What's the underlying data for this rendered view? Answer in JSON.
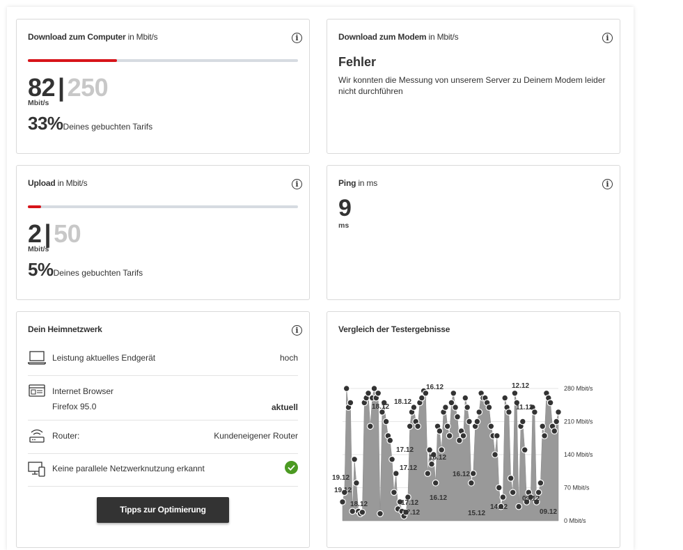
{
  "download_computer": {
    "title_bold": "Download zum Computer",
    "title_unit": "in Mbit/s",
    "value": "82",
    "separator": "|",
    "max": "250",
    "unit": "Mbit/s",
    "percent": "33%",
    "percent_text": "Deines gebuchten Tarifs",
    "progress": 0.33
  },
  "download_modem": {
    "title_bold": "Download zum Modem",
    "title_unit": "in Mbit/s",
    "error_heading": "Fehler",
    "error_text": "Wir konnten die Messung von unserem Server zu Deinem Modem leider nicht durchführen"
  },
  "upload": {
    "title_bold": "Upload",
    "title_unit": "in Mbit/s",
    "value": "2",
    "separator": "|",
    "max": "50",
    "unit": "Mbit/s",
    "percent": "5%",
    "percent_text": "Deines gebuchten Tarifs",
    "progress": 0.05
  },
  "ping": {
    "title_bold": "Ping",
    "title_unit": "in ms",
    "value": "9",
    "unit": "ms"
  },
  "home_network": {
    "title": "Dein Heimnetzwerk",
    "rows": [
      {
        "icon": "laptop-icon",
        "label": "Leistung aktuelles Endgerät",
        "value": "hoch"
      },
      {
        "icon": "browser-icon",
        "label": "Internet Browser",
        "sublabel": "Firefox 95.0",
        "value": "aktuell"
      },
      {
        "icon": "router-icon",
        "label": "Router:",
        "value": "Kundeneigener Router"
      },
      {
        "icon": "devices-icon",
        "label": "Keine parallele Netzwerknutzung erkannt",
        "value_icon": "check-icon"
      }
    ],
    "button": "Tipps zur Optimierung"
  },
  "comparison": {
    "title": "Vergleich der Testergebnisse"
  },
  "colors": {
    "accent": "#d7141a",
    "check": "#4b9a22",
    "area": "#999999",
    "button": "#333333"
  },
  "chart_data": {
    "type": "area",
    "y_unit": "Mbit/s",
    "ylim": [
      0,
      280
    ],
    "y_ticks": [
      "280 Mbit/s",
      "210 Mbit/s",
      "140 Mbit/s",
      "70 Mbit/s",
      "0 Mbit/s"
    ],
    "y_tick_values": [
      280,
      210,
      140,
      70,
      0
    ],
    "values": [
      40,
      60,
      280,
      240,
      250,
      20,
      130,
      80,
      20,
      15,
      18,
      250,
      260,
      270,
      200,
      260,
      280,
      260,
      270,
      15,
      230,
      250,
      210,
      180,
      170,
      130,
      60,
      100,
      25,
      40,
      20,
      10,
      18,
      50,
      200,
      230,
      240,
      210,
      200,
      250,
      260,
      275,
      270,
      100,
      150,
      120,
      140,
      80,
      200,
      190,
      150,
      230,
      240,
      200,
      180,
      250,
      270,
      240,
      220,
      170,
      190,
      180,
      260,
      240,
      210,
      80,
      100,
      200,
      210,
      230,
      270,
      260,
      260,
      250,
      240,
      200,
      180,
      140,
      180,
      70,
      30,
      50,
      260,
      240,
      230,
      90,
      60,
      270,
      250,
      30,
      200,
      210,
      150,
      40,
      60,
      50,
      240,
      230,
      40,
      60,
      80,
      200,
      180,
      270,
      260,
      250,
      200,
      190,
      210,
      230
    ],
    "point_labels": [
      "19.12",
      "19.12",
      "18.12",
      "18.12",
      "18.12",
      "17.12",
      "17.12",
      "17.12",
      "17.12",
      "16.12",
      "16.12",
      "16.12",
      "16.12",
      "15.12",
      "14.12",
      "12.12",
      "11.12",
      "09.12",
      "09.12"
    ],
    "grid": true,
    "legend": "none"
  }
}
